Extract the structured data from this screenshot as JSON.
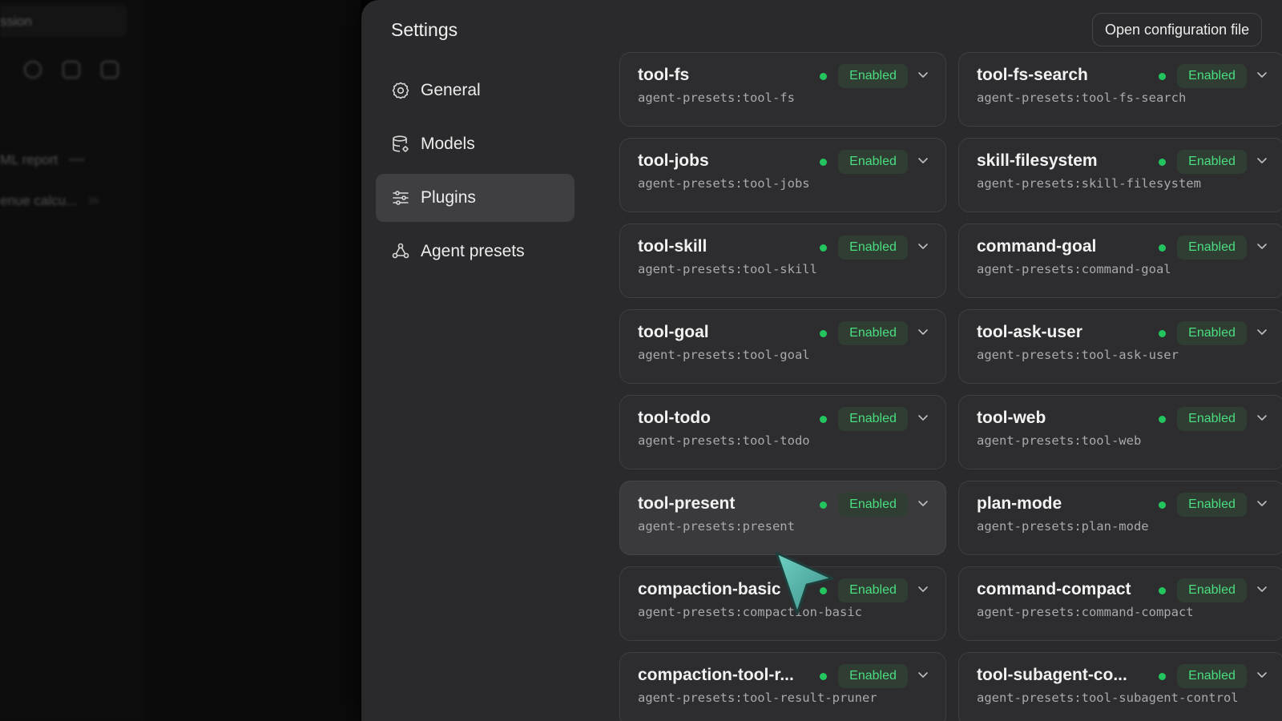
{
  "background_app": {
    "title_fragment": "ssion",
    "rows": [
      {
        "label": "ML report",
        "meta": "•••••"
      },
      {
        "label": "enue calcu...",
        "meta": "1h"
      }
    ]
  },
  "settings": {
    "title": "Settings",
    "open_config_label": "Open configuration file",
    "nav": [
      {
        "label": "General",
        "icon": "gear-icon"
      },
      {
        "label": "Models",
        "icon": "database-icon"
      },
      {
        "label": "Plugins",
        "icon": "sliders-icon",
        "active": true
      },
      {
        "label": "Agent presets",
        "icon": "presets-icon"
      }
    ]
  },
  "plugins": [
    {
      "name": "tool-fs",
      "id": "agent-presets:tool-fs",
      "status": "Enabled"
    },
    {
      "name": "tool-fs-search",
      "id": "agent-presets:tool-fs-search",
      "status": "Enabled"
    },
    {
      "name": "tool-jobs",
      "id": "agent-presets:tool-jobs",
      "status": "Enabled"
    },
    {
      "name": "skill-filesystem",
      "id": "agent-presets:skill-filesystem",
      "status": "Enabled"
    },
    {
      "name": "tool-skill",
      "id": "agent-presets:tool-skill",
      "status": "Enabled"
    },
    {
      "name": "command-goal",
      "id": "agent-presets:command-goal",
      "status": "Enabled"
    },
    {
      "name": "tool-goal",
      "id": "agent-presets:tool-goal",
      "status": "Enabled"
    },
    {
      "name": "tool-ask-user",
      "id": "agent-presets:tool-ask-user",
      "status": "Enabled"
    },
    {
      "name": "tool-todo",
      "id": "agent-presets:tool-todo",
      "status": "Enabled"
    },
    {
      "name": "tool-web",
      "id": "agent-presets:tool-web",
      "status": "Enabled"
    },
    {
      "name": "tool-present",
      "id": "agent-presets:present",
      "status": "Enabled"
    },
    {
      "name": "plan-mode",
      "id": "agent-presets:plan-mode",
      "status": "Enabled"
    },
    {
      "name": "compaction-basic",
      "id": "agent-presets:compaction-basic",
      "status": "Enabled"
    },
    {
      "name": "command-compact",
      "id": "agent-presets:command-compact",
      "status": "Enabled"
    },
    {
      "name": "compaction-tool-r...",
      "id": "agent-presets:tool-result-pruner",
      "status": "Enabled"
    },
    {
      "name": "tool-subagent-co...",
      "id": "agent-presets:tool-subagent-control",
      "status": "Enabled"
    }
  ],
  "colors": {
    "accent_green": "#22c55e",
    "badge_text": "#4ade80",
    "window_bg": "#2a2a2c",
    "active_nav_bg": "#3e3e43",
    "cursor": "#4fb0a6"
  }
}
